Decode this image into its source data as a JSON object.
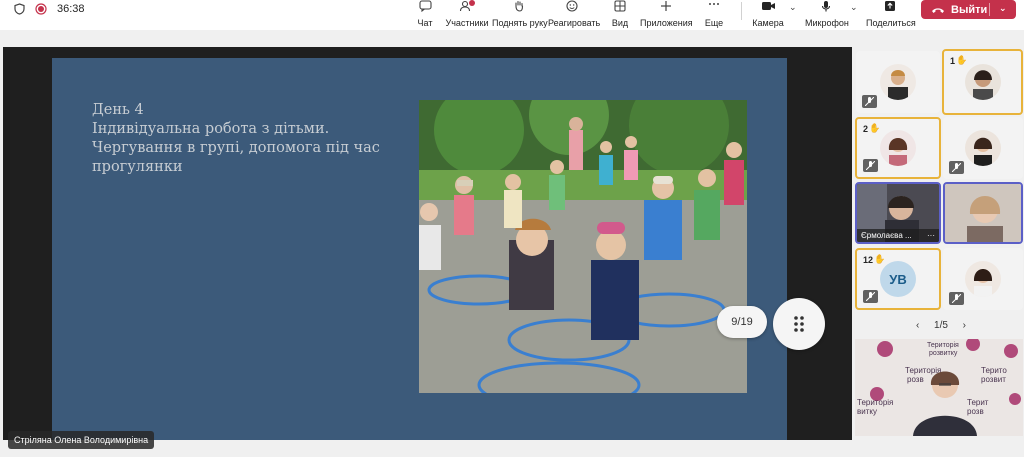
{
  "toolbar": {
    "timer": "36:38",
    "chat": "Чат",
    "participants": "Участники",
    "raise_hand": "Поднять руку",
    "react": "Реагировать",
    "view": "Вид",
    "apps": "Приложения",
    "more": "Еще",
    "camera": "Камера",
    "mic": "Микрофон",
    "share": "Поделиться",
    "leave": "Выйти"
  },
  "slide": {
    "line1": "День 4",
    "line2": "Індивідуальна робота з дітьми.",
    "line3": "Чергування в групі, допомога під час",
    "line4": "прогулянки",
    "counter": "9/19"
  },
  "presenter": {
    "name": "Стріляна Олена Володимирівна"
  },
  "participants": {
    "tile2_hand": "1",
    "tile3_hand": "2",
    "tile5_name": "Єрмолаєва ...",
    "tile5_more": "···",
    "tile7_hand": "12",
    "tile7_initials": "УВ"
  },
  "pager": {
    "label": "1/5"
  },
  "self_video": {
    "sign_1": "Територія",
    "sign_2": "розвитку",
    "sign_3": "Територія",
    "sign_4": "розв",
    "sign_5": "Територія",
    "sign_6": "витку",
    "sign_7": "Терито",
    "sign_8": "розвит",
    "sign_9": "Терит",
    "sign_10": "розв"
  },
  "colors": {
    "accent": "#5b5fc7",
    "leave": "#c4314b",
    "hand_ring": "#e8b33a",
    "slide_bg": "#3c5a7a"
  }
}
